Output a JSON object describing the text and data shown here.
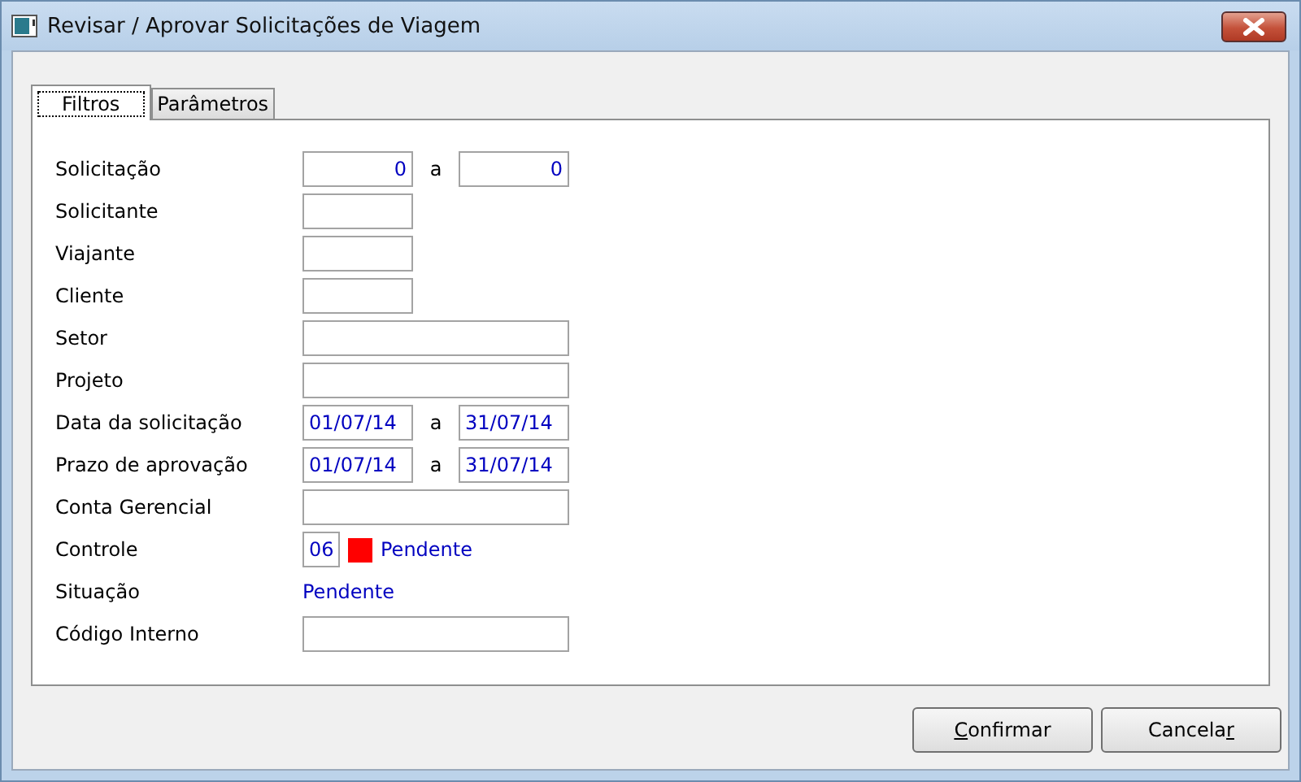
{
  "window": {
    "title": "Revisar / Aprovar Solicitações de Viagem"
  },
  "tabs": [
    {
      "label": "Filtros",
      "selected": true
    },
    {
      "label": "Parâmetros",
      "selected": false
    }
  ],
  "rows": [
    {
      "kind": "number_range",
      "label": "Solicitação",
      "from": "0",
      "to": "0",
      "separator": "a"
    },
    {
      "kind": "short_field",
      "label": "Solicitante"
    },
    {
      "kind": "short_field",
      "label": "Viajante"
    },
    {
      "kind": "short_field",
      "label": "Cliente"
    },
    {
      "kind": "long_field",
      "label": "Setor"
    },
    {
      "kind": "long_field",
      "label": "Projeto"
    },
    {
      "kind": "date_range",
      "label": "Data da solicitação",
      "from": "01/07/14",
      "to": "31/07/14",
      "separator": "a"
    },
    {
      "kind": "date_range",
      "label": "Prazo de aprovação",
      "from": "01/07/14",
      "to": "31/07/14",
      "separator": "a"
    },
    {
      "kind": "long_field",
      "label": "Conta Gerencial"
    },
    {
      "kind": "control",
      "label": "Controle",
      "code": "06",
      "color": "#ff0000",
      "status": "Pendente"
    },
    {
      "kind": "text",
      "label": "Situação",
      "value": "Pendente"
    },
    {
      "kind": "long_field",
      "label": "Código Interno"
    }
  ],
  "buttons": [
    {
      "accel": "C",
      "after": "onfirmar"
    },
    {
      "before": "Cancela",
      "accel": "r"
    }
  ]
}
